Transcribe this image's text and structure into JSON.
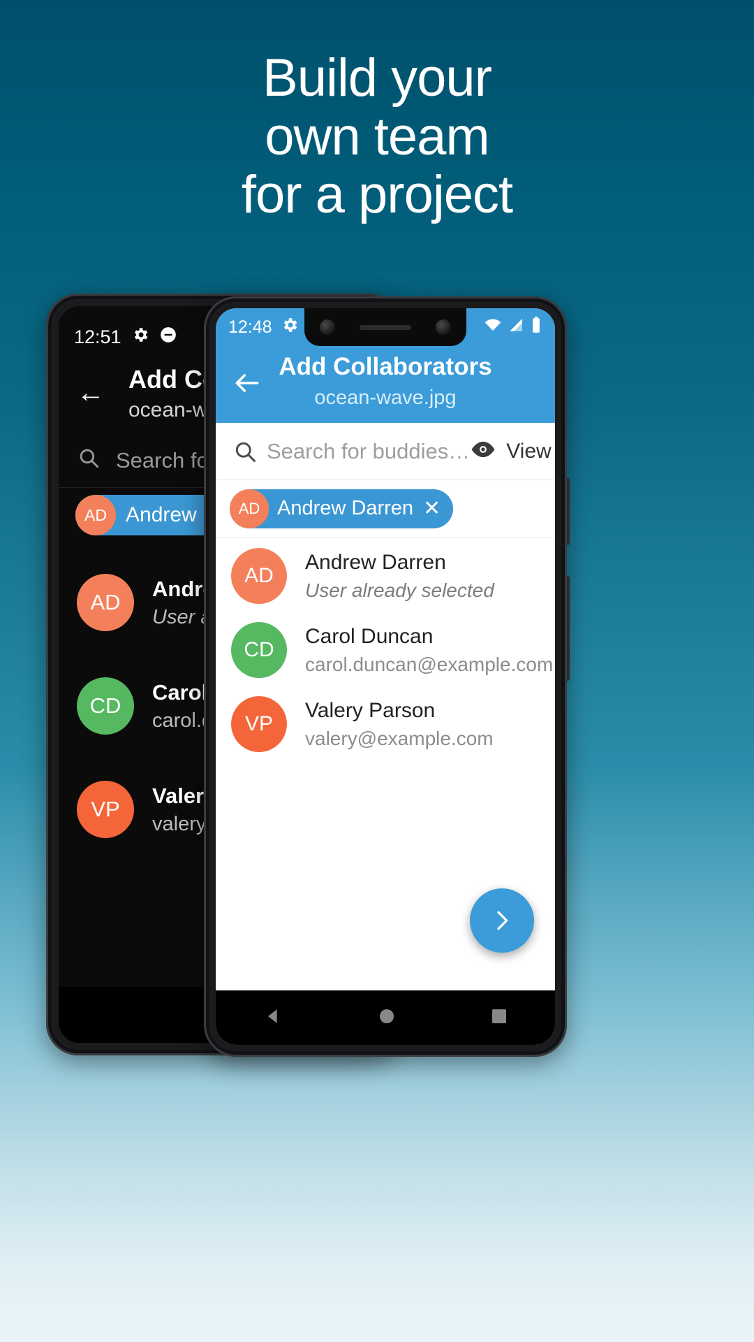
{
  "promo": {
    "headline_lines": [
      "Build your",
      "own team",
      "for a project"
    ],
    "background_top_color": "#00506b",
    "background_bottom_color": "#eaf4f8"
  },
  "front_phone": {
    "status_bar": {
      "time": "12:48",
      "icons_left": [
        "gear-icon",
        "do-not-disturb-icon"
      ],
      "icons_right": [
        "wifi-icon",
        "signal-icon",
        "battery-icon"
      ],
      "background_color": "#3b9cd9"
    },
    "app_bar": {
      "back_label": "←",
      "title": "Add Collaborators",
      "subtitle": "ocean-wave.jpg",
      "background_color": "#3b9cd9"
    },
    "search": {
      "placeholder": "Search for buddies…",
      "value": "",
      "view_label": "View",
      "chevron": "›"
    },
    "selected_chips": [
      {
        "initials": "AD",
        "name": "Andrew Darren",
        "remove_label": "✕",
        "avatar_color": "#f4805b",
        "chip_color": "#3b97d3"
      }
    ],
    "contacts": [
      {
        "initials": "AD",
        "name": "Andrew Darren",
        "detail": "User already selected",
        "detail_italic": true,
        "avatar_color": "#f4805b"
      },
      {
        "initials": "CD",
        "name": "Carol Duncan",
        "detail": "carol.duncan@example.com",
        "detail_italic": false,
        "avatar_color": "#56b961"
      },
      {
        "initials": "VP",
        "name": "Valery Parson",
        "detail": "valery@example.com",
        "detail_italic": false,
        "avatar_color": "#f4663a"
      }
    ],
    "fab": {
      "label": "›",
      "color": "#3b9cd9"
    },
    "nav_bar": {
      "back": "back-triangle-icon",
      "home": "home-circle-icon",
      "recents": "recents-square-icon"
    }
  },
  "back_phone": {
    "status_bar": {
      "time": "12:51",
      "icons_left": [
        "gear-icon",
        "do-not-disturb-icon"
      ]
    },
    "app_bar": {
      "back_label": "←",
      "title": "Add Collab",
      "subtitle": "ocean-wave.jp"
    },
    "search": {
      "placeholder": "Search for bud"
    },
    "selected_chips": [
      {
        "initials": "AD",
        "name": "Andrew Darren",
        "avatar_color": "#f4805b"
      }
    ],
    "contacts": [
      {
        "initials": "AD",
        "name": "Andrew Darr",
        "detail": "User already",
        "detail_italic": true,
        "avatar_color": "#f4805b"
      },
      {
        "initials": "CD",
        "name": "Carol Duncan",
        "detail": "carol.duncan",
        "detail_italic": false,
        "avatar_color": "#56b961"
      },
      {
        "initials": "VP",
        "name": "Valery Parso",
        "detail": "valery@exan",
        "detail_italic": false,
        "avatar_color": "#f4663a"
      }
    ]
  }
}
